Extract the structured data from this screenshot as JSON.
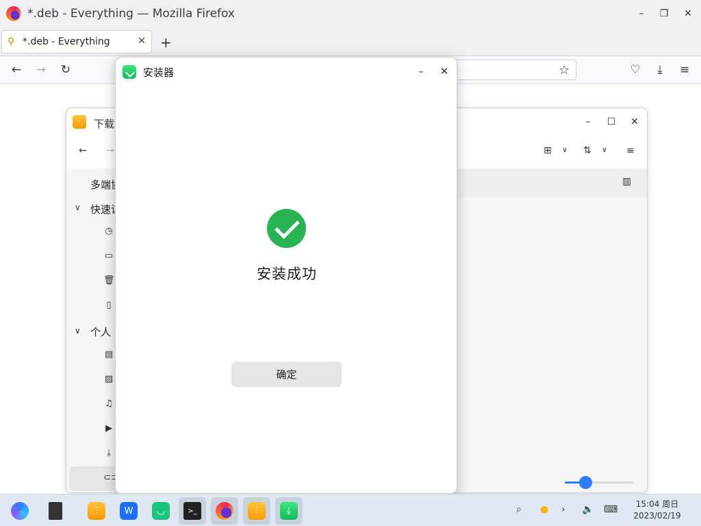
{
  "firefox": {
    "window_title": "*.deb - Everything — Mozilla Firefox",
    "tab_label": "*.deb - Everything",
    "new_tab": "+",
    "minimize": "–",
    "restore": "❐",
    "close": "✕"
  },
  "file_manager": {
    "title": "下载",
    "sidebar": {
      "multi_device": "多端协",
      "quick_access": "快速访",
      "personal": "个人"
    }
  },
  "installer": {
    "title": "安装器",
    "success_message": "安装成功",
    "ok_button": "确定",
    "accent_color": "#29b352"
  },
  "taskbar": {
    "clock_time": "15:04 周日",
    "clock_date": "2023/02/19",
    "apps": [
      "start-menu",
      "multitask-view",
      "file-manager",
      "wps",
      "messenger",
      "terminal",
      "firefox",
      "file-manager-2",
      "installer"
    ]
  },
  "zoom_slider": {
    "value": 0.3
  }
}
